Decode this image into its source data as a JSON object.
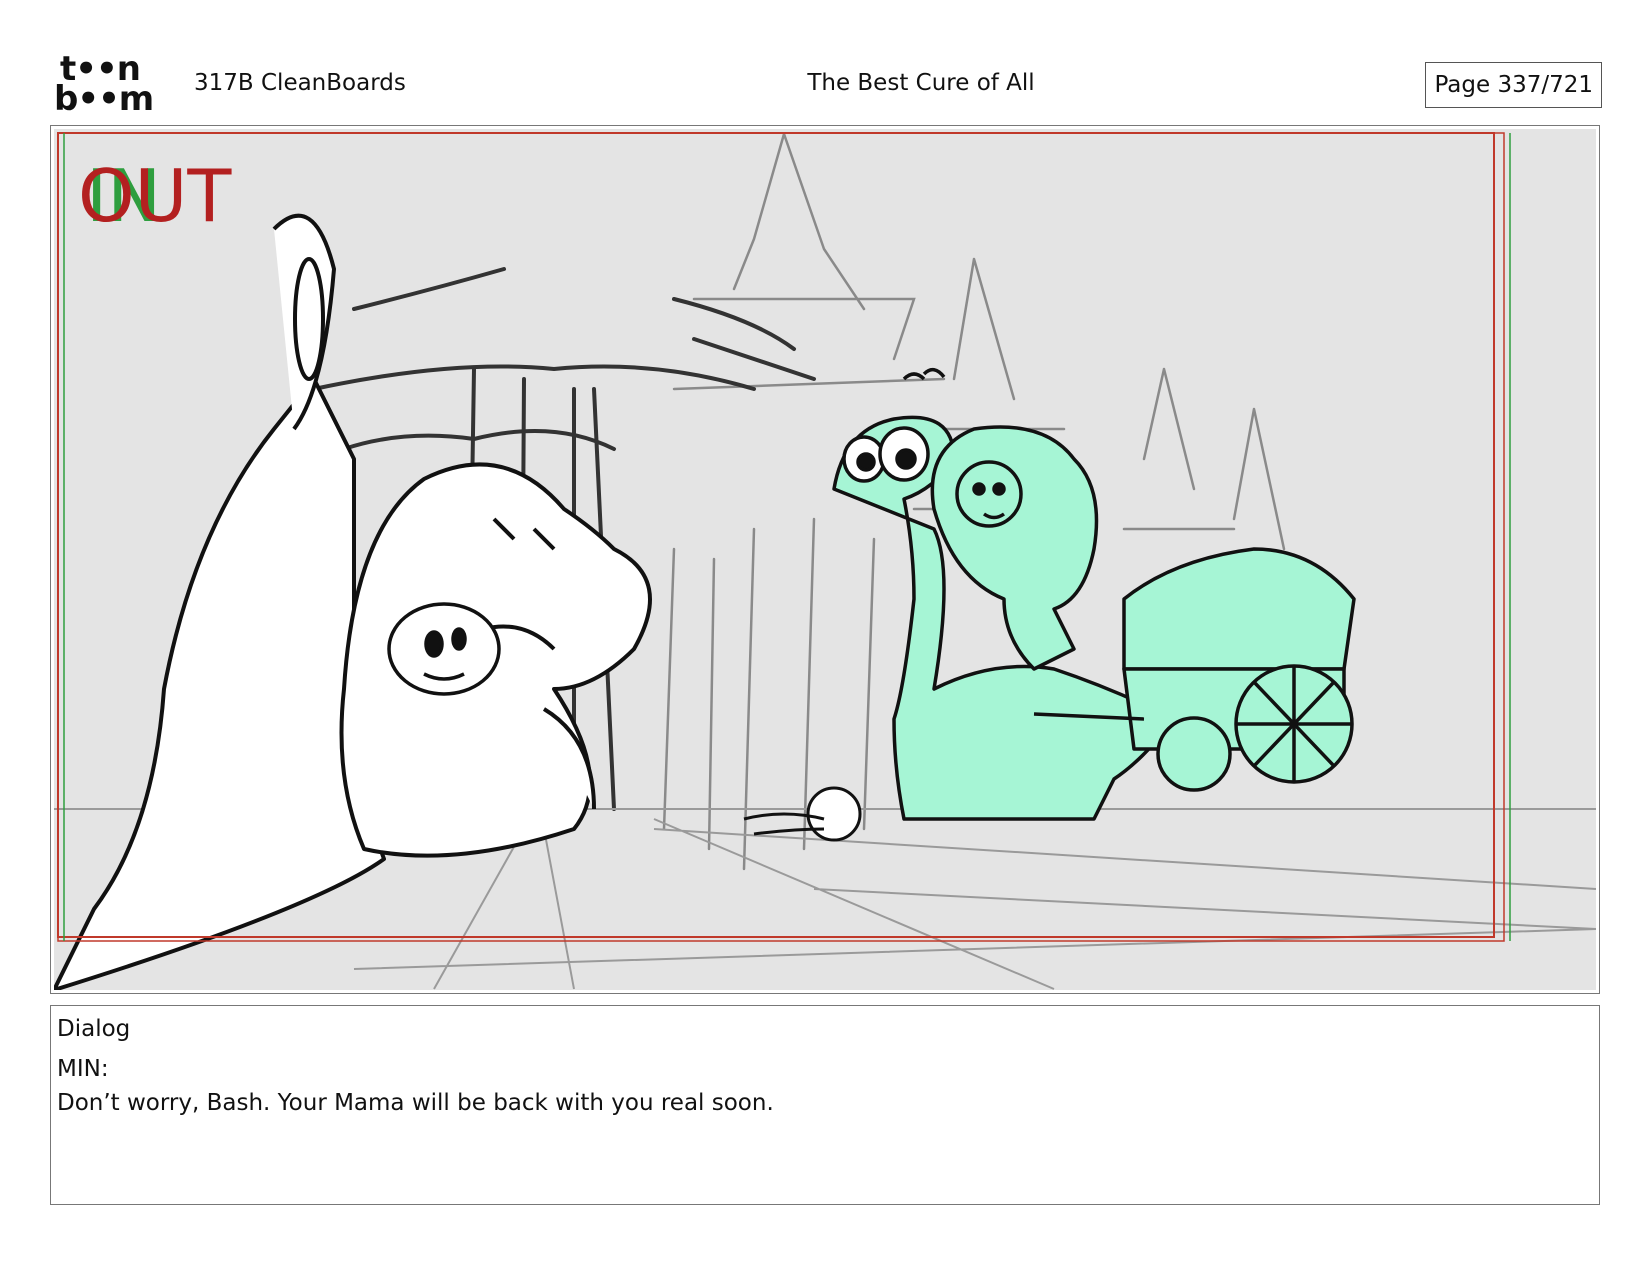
{
  "header": {
    "logo_line1": "t••n",
    "logo_line2": "b••m",
    "episode": "317B  CleanBoards",
    "title": "The Best Cure of All",
    "page": "Page 337/721"
  },
  "panel": {
    "safe_area_label_in": "IN",
    "safe_area_label_out": "OUT",
    "colors": {
      "background": "#e4e4e4",
      "trees": "#8a8a8a",
      "sketch_line": "#111111",
      "highlight_character": "#a6f5d5",
      "frame_red": "#c0392b",
      "frame_green": "#2e9e3e"
    }
  },
  "dialog": {
    "heading": "Dialog",
    "speaker": "MIN:",
    "line": "Don’t worry, Bash. Your Mama will be back with you real soon."
  }
}
